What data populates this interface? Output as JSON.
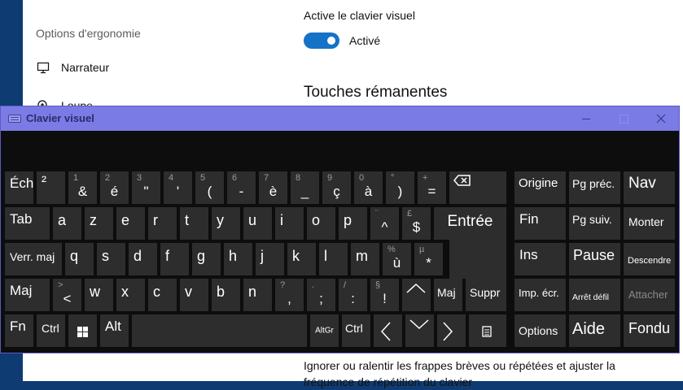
{
  "settings": {
    "section_header": "Options d'ergonomie",
    "nav": [
      {
        "label": "Narrateur",
        "icon": "narrator-icon"
      },
      {
        "label": "Loupe",
        "icon": "magnifier-icon"
      }
    ],
    "osk_setting_label": "Active le clavier visuel",
    "toggle_state": "Activé",
    "toggle_on": true,
    "sticky_heading": "Touches rémanentes",
    "filter_description": "Ignorer ou ralentir les frappes brèves ou répétées et ajuster la fréquence de répétition du clavier"
  },
  "osk": {
    "title": "Clavier visuel",
    "window_buttons": {
      "minimize": "minimize-icon",
      "maximize": "maximize-icon",
      "close": "close-icon"
    },
    "colors": {
      "titlebar": "#7b7be6",
      "key": "#2d2d2d",
      "background": "#0d0d0d",
      "accent": "#1572c7"
    },
    "row1": {
      "esc": "Éch",
      "sq": "²",
      "keys": [
        {
          "shift": "1",
          "main": "&"
        },
        {
          "shift": "2",
          "main": "é"
        },
        {
          "shift": "3",
          "main": "\""
        },
        {
          "shift": "4",
          "main": "'"
        },
        {
          "shift": "5",
          "main": "("
        },
        {
          "shift": "6",
          "main": "-"
        },
        {
          "shift": "7",
          "main": "è"
        },
        {
          "shift": "8",
          "main": "_"
        },
        {
          "shift": "9",
          "main": "ç"
        },
        {
          "shift": "0",
          "main": "à"
        },
        {
          "shift": "°",
          "main": ")"
        },
        {
          "shift": "+",
          "main": "="
        }
      ],
      "backspace_icon": "backspace-icon"
    },
    "row2": {
      "tab": "Tab",
      "letters": [
        "a",
        "z",
        "e",
        "r",
        "t",
        "y",
        "u",
        "i",
        "o",
        "p"
      ],
      "keys": [
        {
          "shift": "¨",
          "main": "^"
        },
        {
          "shift": "£",
          "main": "$"
        }
      ],
      "enter": "Entrée"
    },
    "row3": {
      "caps": "Verr. maj",
      "letters": [
        "q",
        "s",
        "d",
        "f",
        "g",
        "h",
        "j",
        "k",
        "l",
        "m"
      ],
      "keys": [
        {
          "shift": "%",
          "main": "ù"
        },
        {
          "shift": "µ",
          "main": "*"
        }
      ]
    },
    "row4": {
      "shift_left": "Maj",
      "lt": {
        "shift": ">",
        "main": "<"
      },
      "letters": [
        "w",
        "x",
        "c",
        "v",
        "b",
        "n"
      ],
      "keys": [
        {
          "shift": "?",
          "main": ","
        },
        {
          "shift": ".",
          "main": ";"
        },
        {
          "shift": "/",
          "main": ":"
        },
        {
          "shift": "§",
          "main": "!"
        }
      ],
      "up_icon": "arrow-up-icon",
      "shift_right": "Maj",
      "delete": "Suppr"
    },
    "row5": {
      "fn": "Fn",
      "ctrl_left": "Ctrl",
      "windows_icon": "windows-logo-icon",
      "alt": "Alt",
      "altgr": "AltGr",
      "ctrl_right": "Ctrl",
      "left_icon": "arrow-left-icon",
      "down_icon": "arrow-down-icon",
      "right_icon": "arrow-right-icon",
      "menu_icon": "context-menu-icon"
    },
    "nav_keys": {
      "origine": "Origine",
      "pgprec": "Pg préc.",
      "nav": "Nav",
      "fin": "Fin",
      "pgsuiv": "Pg suiv.",
      "monter": "Monter",
      "ins": "Ins",
      "pause": "Pause",
      "descendre": "Descendre",
      "impecr": "Imp. écr.",
      "arretdefil": "Arrêt défil",
      "attacher": "Attacher",
      "options": "Options",
      "aide": "Aide",
      "fondu": "Fondu"
    }
  }
}
